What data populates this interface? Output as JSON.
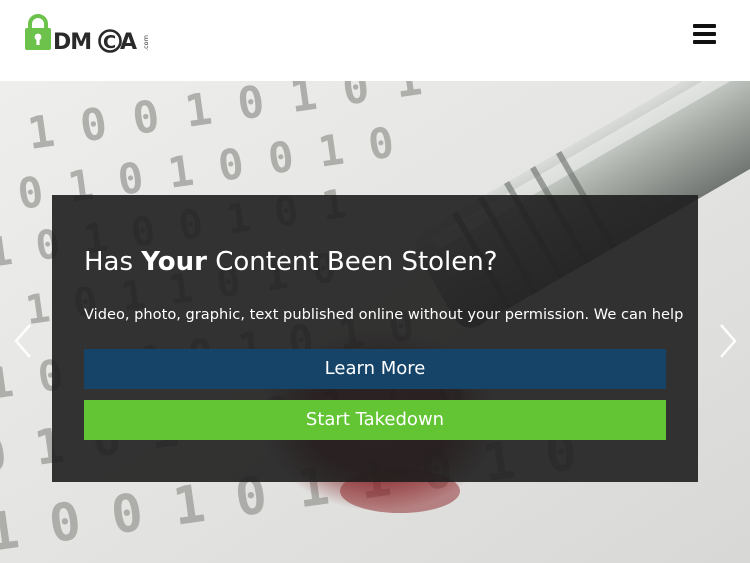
{
  "header": {
    "logo": {
      "text": "DMCA",
      "suffix": ".com",
      "lock_color": "#6cc24a",
      "text_color": "#2a2a2a"
    },
    "menu_icon": "hamburger-menu-icon"
  },
  "hero": {
    "background_description_icon": "binary-pen-photo",
    "nav": {
      "prev_icon": "chevron-left-icon",
      "next_icon": "chevron-right-icon"
    },
    "headline": {
      "before": "Has ",
      "emphasis": "Your",
      "after": " Content Been Stolen?"
    },
    "subtext": "Video, photo, graphic, text published online without your permission. We can help",
    "buttons": {
      "learn_more": "Learn More",
      "start_takedown": "Start Takedown"
    },
    "colors": {
      "panel": "#1e1e1e",
      "learn_more": "#164468",
      "start_takedown": "#63c434",
      "text": "#ffffff"
    }
  }
}
